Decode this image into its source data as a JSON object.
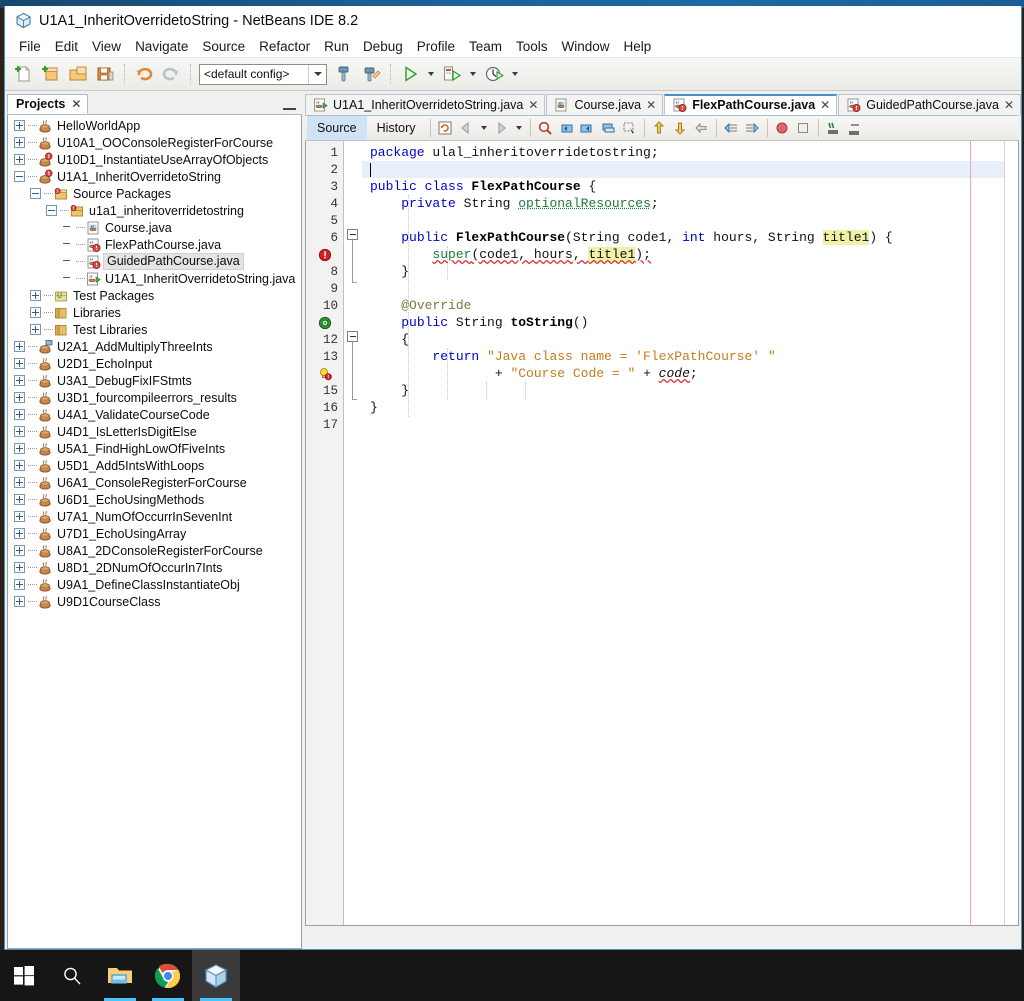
{
  "window": {
    "title": "U1A1_InheritOverridetoString - NetBeans IDE 8.2",
    "icon": "netbeans-cube-icon"
  },
  "menubar": {
    "items": [
      "File",
      "Edit",
      "View",
      "Navigate",
      "Source",
      "Refactor",
      "Run",
      "Debug",
      "Profile",
      "Team",
      "Tools",
      "Window",
      "Help"
    ]
  },
  "toolbar": {
    "config_value": "<default config>",
    "buttons": [
      "new-file-icon",
      "new-project-icon",
      "open-project-icon",
      "save-all-icon",
      "undo-icon",
      "redo-icon",
      "build-project-icon",
      "clean-and-build-icon",
      "run-project-icon",
      "debug-project-icon",
      "profile-project-icon"
    ]
  },
  "projects_panel": {
    "tab_label": "Projects",
    "close_label": "✕",
    "tree": [
      {
        "label": "HelloWorldApp",
        "depth": 0,
        "expander": "plus",
        "icon": "java-project-icon"
      },
      {
        "label": "U10A1_OOConsoleRegisterForCourse",
        "depth": 0,
        "expander": "plus",
        "icon": "java-project-icon"
      },
      {
        "label": "U10D1_InstantiateUseArrayOfObjects",
        "depth": 0,
        "expander": "plus",
        "icon": "java-project-main-icon"
      },
      {
        "label": "U1A1_InheritOverridetoString",
        "depth": 0,
        "expander": "minus",
        "icon": "java-project-main-icon"
      },
      {
        "label": "Source Packages",
        "depth": 1,
        "expander": "minus",
        "icon": "source-packages-icon"
      },
      {
        "label": "u1a1_inheritoverridetostring",
        "depth": 2,
        "expander": "minus",
        "icon": "package-icon"
      },
      {
        "label": "Course.java",
        "depth": 3,
        "expander": "none",
        "icon": "java-file-icon"
      },
      {
        "label": "FlexPathCourse.java",
        "depth": 3,
        "expander": "none",
        "icon": "java-file-error-icon"
      },
      {
        "label": "GuidedPathCourse.java",
        "depth": 3,
        "expander": "none",
        "icon": "java-file-error-icon",
        "selected": true
      },
      {
        "label": "U1A1_InheritOverridetoString.java",
        "depth": 3,
        "expander": "none",
        "icon": "java-main-file-icon"
      },
      {
        "label": "Test Packages",
        "depth": 1,
        "expander": "plus",
        "icon": "test-packages-icon"
      },
      {
        "label": "Libraries",
        "depth": 1,
        "expander": "plus",
        "icon": "libraries-icon"
      },
      {
        "label": "Test Libraries",
        "depth": 1,
        "expander": "plus",
        "icon": "libraries-icon"
      },
      {
        "label": "U2A1_AddMultiplyThreeInts",
        "depth": 0,
        "expander": "plus",
        "icon": "java-project-open-icon"
      },
      {
        "label": "U2D1_EchoInput",
        "depth": 0,
        "expander": "plus",
        "icon": "java-project-icon"
      },
      {
        "label": "U3A1_DebugFixIFStmts",
        "depth": 0,
        "expander": "plus",
        "icon": "java-project-icon"
      },
      {
        "label": "U3D1_fourcompileerrors_results",
        "depth": 0,
        "expander": "plus",
        "icon": "java-project-icon"
      },
      {
        "label": "U4A1_ValidateCourseCode",
        "depth": 0,
        "expander": "plus",
        "icon": "java-project-icon"
      },
      {
        "label": "U4D1_IsLetterIsDigitElse",
        "depth": 0,
        "expander": "plus",
        "icon": "java-project-icon"
      },
      {
        "label": "U5A1_FindHighLowOfFiveInts",
        "depth": 0,
        "expander": "plus",
        "icon": "java-project-icon"
      },
      {
        "label": "U5D1_Add5IntsWithLoops",
        "depth": 0,
        "expander": "plus",
        "icon": "java-project-icon"
      },
      {
        "label": "U6A1_ConsoleRegisterForCourse",
        "depth": 0,
        "expander": "plus",
        "icon": "java-project-icon"
      },
      {
        "label": "U6D1_EchoUsingMethods",
        "depth": 0,
        "expander": "plus",
        "icon": "java-project-icon"
      },
      {
        "label": "U7A1_NumOfOccurrInSevenInt",
        "depth": 0,
        "expander": "plus",
        "icon": "java-project-icon"
      },
      {
        "label": "U7D1_EchoUsingArray",
        "depth": 0,
        "expander": "plus",
        "icon": "java-project-icon"
      },
      {
        "label": "U8A1_2DConsoleRegisterForCourse",
        "depth": 0,
        "expander": "plus",
        "icon": "java-project-icon"
      },
      {
        "label": "U8D1_2DNumOfOccurIn7Ints",
        "depth": 0,
        "expander": "plus",
        "icon": "java-project-icon"
      },
      {
        "label": "U9A1_DefineClassInstantiateObj",
        "depth": 0,
        "expander": "plus",
        "icon": "java-project-icon"
      },
      {
        "label": "U9D1CourseClass",
        "depth": 0,
        "expander": "plus",
        "icon": "java-project-icon"
      }
    ]
  },
  "editor": {
    "tabs": [
      {
        "label": "U1A1_InheritOverridetoString.java",
        "icon": "java-main-file-icon",
        "active": false,
        "close": "✕"
      },
      {
        "label": "Course.java",
        "icon": "java-file-icon",
        "active": false,
        "close": "✕"
      },
      {
        "label": "FlexPathCourse.java",
        "icon": "java-file-error-icon",
        "active": true,
        "close": "✕"
      },
      {
        "label": "GuidedPathCourse.java",
        "icon": "java-file-error-icon",
        "active": false,
        "close": "✕"
      }
    ],
    "toolbar": {
      "source_label": "Source",
      "history_label": "History",
      "buttons": [
        "refresh-icon",
        "back-icon",
        "forward-icon",
        "find-selection-icon",
        "previous-bookmark-icon",
        "next-bookmark-icon",
        "toggle-bookmark-icon",
        "rectangular-selection-icon",
        "previous-error-icon",
        "next-error-icon",
        "shift-line-icon",
        "shift-left-icon",
        "shift-right-icon",
        "toggle-breakpoint-icon",
        "stop-icon",
        "comment-icon",
        "uncomment-icon"
      ]
    },
    "gutter": {
      "lines": [
        {
          "n": "1",
          "mark": null
        },
        {
          "n": "2",
          "mark": null
        },
        {
          "n": "3",
          "mark": null
        },
        {
          "n": "4",
          "mark": null
        },
        {
          "n": "5",
          "mark": null
        },
        {
          "n": "6",
          "mark": null
        },
        {
          "n": "7",
          "mark": "error-badge-icon"
        },
        {
          "n": "8",
          "mark": null
        },
        {
          "n": "9",
          "mark": null
        },
        {
          "n": "10",
          "mark": null
        },
        {
          "n": "11",
          "mark": "override-annotation-icon"
        },
        {
          "n": "12",
          "mark": null
        },
        {
          "n": "13",
          "mark": null
        },
        {
          "n": "14",
          "mark": "hint-error-icon"
        },
        {
          "n": "15",
          "mark": null
        },
        {
          "n": "16",
          "mark": null
        },
        {
          "n": "17",
          "mark": null
        }
      ]
    },
    "code_lines": [
      {
        "n": 1,
        "caret": false,
        "tokens": [
          {
            "t": "package ",
            "c": "k"
          },
          {
            "t": "ulal_inheritoverridetostring;",
            "c": "plain"
          }
        ]
      },
      {
        "n": 2,
        "caret": true,
        "tokens": []
      },
      {
        "n": 3,
        "caret": false,
        "tokens": [
          {
            "t": "public class ",
            "c": "k"
          },
          {
            "t": "FlexPathCourse",
            "c": "cls"
          },
          {
            "t": " {",
            "c": "plain"
          }
        ]
      },
      {
        "n": 4,
        "caret": false,
        "tokens": [
          {
            "t": "    ",
            "c": "plain"
          },
          {
            "t": "private ",
            "c": "k"
          },
          {
            "t": "String ",
            "c": "plain"
          },
          {
            "t": "optionalResources",
            "c": "fld"
          },
          {
            "t": ";",
            "c": "plain"
          }
        ]
      },
      {
        "n": 5,
        "caret": false,
        "tokens": []
      },
      {
        "n": 6,
        "caret": false,
        "tokens": [
          {
            "t": "    ",
            "c": "plain"
          },
          {
            "t": "public ",
            "c": "k"
          },
          {
            "t": "FlexPathCourse",
            "c": "cls"
          },
          {
            "t": "(String code1, ",
            "c": "plain"
          },
          {
            "t": "int ",
            "c": "k"
          },
          {
            "t": "hours, String ",
            "c": "plain"
          },
          {
            "t": "title1",
            "c": "hl"
          },
          {
            "t": ") {",
            "c": "plain"
          }
        ]
      },
      {
        "n": 7,
        "caret": false,
        "tokens": [
          {
            "t": "        ",
            "c": "plain"
          },
          {
            "t": "super",
            "c": "err-link"
          },
          {
            "t": "(code1, hours, ",
            "c": "err-plain"
          },
          {
            "t": "title1",
            "c": "hl-err"
          },
          {
            "t": ");",
            "c": "err-plain"
          }
        ]
      },
      {
        "n": 8,
        "caret": false,
        "tokens": [
          {
            "t": "    }",
            "c": "plain"
          }
        ]
      },
      {
        "n": 9,
        "caret": false,
        "tokens": []
      },
      {
        "n": 10,
        "caret": false,
        "tokens": [
          {
            "t": "    ",
            "c": "plain"
          },
          {
            "t": "@Override",
            "c": "anno"
          }
        ]
      },
      {
        "n": 11,
        "caret": false,
        "tokens": [
          {
            "t": "    ",
            "c": "plain"
          },
          {
            "t": "public ",
            "c": "k"
          },
          {
            "t": "String ",
            "c": "plain"
          },
          {
            "t": "toString",
            "c": "cls"
          },
          {
            "t": "()",
            "c": "plain"
          }
        ]
      },
      {
        "n": 12,
        "caret": false,
        "tokens": [
          {
            "t": "    {",
            "c": "plain"
          }
        ]
      },
      {
        "n": 13,
        "caret": false,
        "tokens": [
          {
            "t": "        ",
            "c": "plain"
          },
          {
            "t": "return ",
            "c": "k"
          },
          {
            "t": "\"Java class name = 'FlexPathCourse' \"",
            "c": "str"
          }
        ]
      },
      {
        "n": 14,
        "caret": false,
        "tokens": [
          {
            "t": "                + ",
            "c": "plain"
          },
          {
            "t": "\"Course Code = \"",
            "c": "str"
          },
          {
            "t": " + ",
            "c": "plain"
          },
          {
            "t": "code",
            "c": "err-italic"
          },
          {
            "t": ";",
            "c": "plain"
          }
        ]
      },
      {
        "n": 15,
        "caret": false,
        "tokens": [
          {
            "t": "    }",
            "c": "plain"
          }
        ]
      },
      {
        "n": 16,
        "caret": false,
        "tokens": [
          {
            "t": "}",
            "c": "plain"
          }
        ]
      },
      {
        "n": 17,
        "caret": false,
        "tokens": []
      }
    ]
  },
  "taskbar": {
    "items": [
      {
        "name": "start-button",
        "icon": "windows-logo-icon",
        "running": false,
        "active": false
      },
      {
        "name": "search-button",
        "icon": "search-icon",
        "running": false,
        "active": false
      },
      {
        "name": "file-explorer",
        "icon": "folder-icon",
        "running": true,
        "active": false
      },
      {
        "name": "google-chrome",
        "icon": "chrome-icon",
        "running": true,
        "active": false
      },
      {
        "name": "netbeans-ide",
        "icon": "netbeans-cube-icon",
        "running": true,
        "active": true
      }
    ]
  },
  "colors": {
    "accent": "#4cc2ff",
    "keyword": "#0000cd",
    "string": "#c87b1e",
    "field": "#1a7a3c",
    "highlight": "#f0f0a8",
    "error": "#e03030",
    "caret_line": "#e8eefa",
    "margin_guide": "#f4a7ad"
  }
}
